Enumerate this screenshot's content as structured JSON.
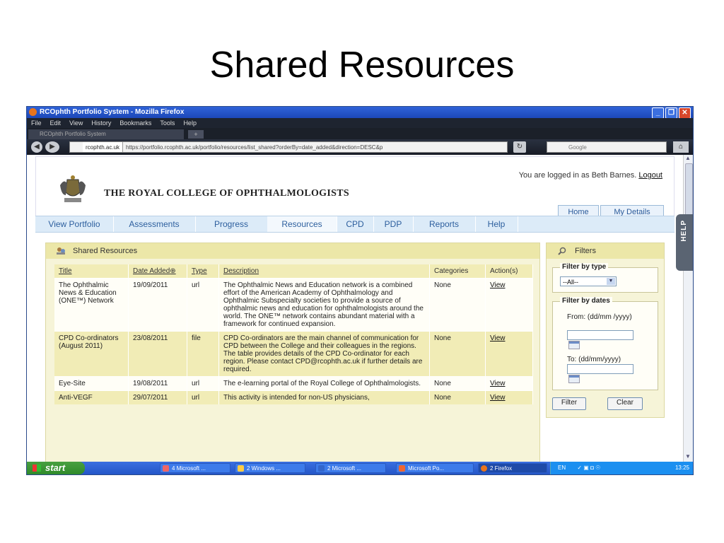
{
  "slide_title": "Shared Resources",
  "window": {
    "title": "RCOphth Portfolio System - Mozilla Firefox",
    "menu": [
      "File",
      "Edit",
      "View",
      "History",
      "Bookmarks",
      "Tools",
      "Help"
    ],
    "tab_title": "RCOphth Portfolio System",
    "url_site": "rcophth.ac.uk",
    "url": "https://portfolio.rcophth.ac.uk/portfolio/resources/list_shared?orderBy=date_added&direction=DESC&p",
    "search_placeholder": "Google"
  },
  "header": {
    "college_name": "THE ROYAL COLLEGE OF OPHTHALMOLOGISTS",
    "logged_in_text": "You are logged in as Beth Barnes.",
    "logout": "Logout",
    "tabs": [
      "Home",
      "My Details"
    ]
  },
  "nav": {
    "items": [
      "View Portfolio",
      "Assessments",
      "Progress",
      "Resources",
      "CPD",
      "PDP",
      "Reports",
      "Help"
    ],
    "active": "Resources"
  },
  "resources": {
    "heading": "Shared Resources",
    "columns": [
      "Title",
      "Date Added",
      "Type",
      "Description",
      "Categories",
      "Action(s)"
    ],
    "rows": [
      {
        "title": "The Ophthalmic News & Education (ONE™) Network",
        "date": "19/09/2011",
        "type": "url",
        "description": "The Ophthalmic News and Education network is a combined effort of the American Academy of Ophthalmology and Ophthalmic Subspecialty societies to provide a source of ophthalmic news and education for ophthalmologists around the world. The ONE™ network contains abundant material with a framework for continued expansion.",
        "categories": "None",
        "action": "View"
      },
      {
        "title": "CPD Co-ordinators (August 2011)",
        "date": "23/08/2011",
        "type": "file",
        "description": "CPD Co-ordinators are the main channel of communication for CPD between the College and their colleagues in the regions. The table provides details of the CPD Co-ordinator for each region. Please contact CPD@rcophth.ac.uk if further details are required.",
        "categories": "None",
        "action": "View"
      },
      {
        "title": "Eye-Site",
        "date": "19/08/2011",
        "type": "url",
        "description": "The e-learning portal of the Royal College of Ophthalmologists.",
        "categories": "None",
        "action": "View"
      },
      {
        "title": "Anti-VEGF",
        "date": "29/07/2011",
        "type": "url",
        "description": "This activity is intended for non-US physicians,",
        "categories": "None",
        "action": "View"
      }
    ]
  },
  "filters": {
    "heading": "Filters",
    "by_type": "Filter by type",
    "type_value": "--All--",
    "by_dates": "Filter by dates",
    "from_label": "From: (dd/mm /yyyy)",
    "to_label": "To: (dd/mm/yyyy)",
    "filter_button": "Filter",
    "clear_button": "Clear"
  },
  "help_tab": "HELP",
  "taskbar": {
    "start": "start",
    "tasks": [
      "4 Microsoft ...",
      "2 Windows ...",
      "2 Microsoft ...",
      "Microsoft Po...",
      "2 Firefox"
    ],
    "lang": "EN",
    "clock": "13:25"
  },
  "colors": {
    "panel_bg": "#f6f4d8",
    "panel_head": "#ece7a8",
    "nav_bg": "#dcebf8",
    "nav_text": "#2d5f9e"
  }
}
